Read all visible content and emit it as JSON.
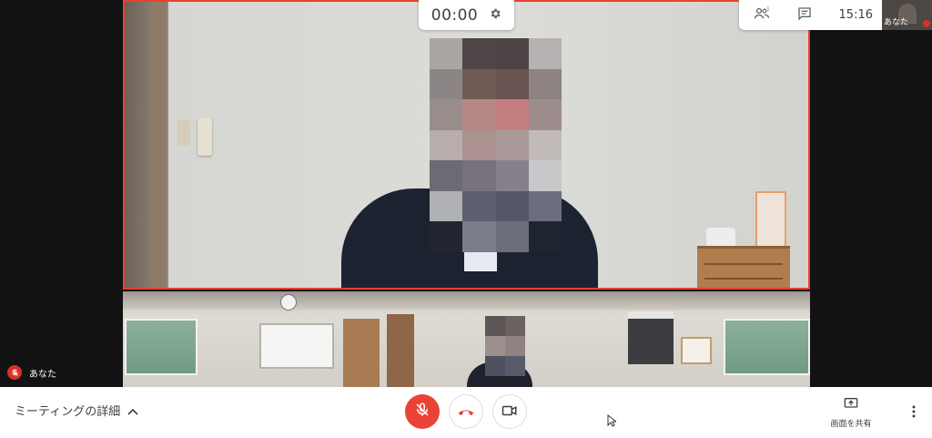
{
  "call": {
    "timer": "00:00",
    "clock": "15:16",
    "self_name": "あなた"
  },
  "controls": {
    "meeting_details_label": "ミーティングの詳細",
    "present_label": "画面を共有"
  },
  "icons": {
    "settings": "gear-icon",
    "people": "people-icon",
    "chat": "chat-icon",
    "mic": "mic-off-icon",
    "hangup": "phone-hangup-icon",
    "camera": "videocam-icon",
    "present": "present-screen-icon",
    "more": "more-vert-icon",
    "chevron": "chevron-up-icon"
  },
  "colors": {
    "active_speaker_border": "#e8412f",
    "mic_off_red": "#ea4335",
    "toolbar_bg": "#ffffff",
    "text": "#3c4043"
  }
}
